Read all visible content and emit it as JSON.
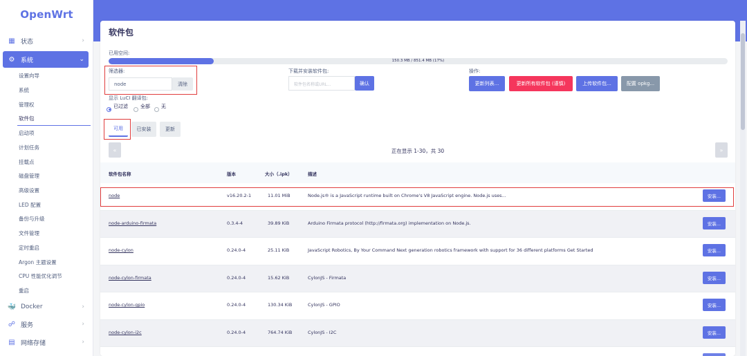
{
  "brand": "OpenWrt",
  "sidebar": {
    "top_items": [
      {
        "label": "状态"
      },
      {
        "label": "系统"
      },
      {
        "label": "Docker"
      },
      {
        "label": "服务"
      },
      {
        "label": "网络存储"
      }
    ],
    "sub_items": [
      {
        "label": "设置向导"
      },
      {
        "label": "系统"
      },
      {
        "label": "管理权"
      },
      {
        "label": "软件包"
      },
      {
        "label": "启动项"
      },
      {
        "label": "计划任务"
      },
      {
        "label": "挂载点"
      },
      {
        "label": "磁盘管理"
      },
      {
        "label": "高级设置"
      },
      {
        "label": "LED 配置"
      },
      {
        "label": "备份与升级"
      },
      {
        "label": "文件管理"
      },
      {
        "label": "定时重启"
      },
      {
        "label": "Argon 主题设置"
      },
      {
        "label": "CPU 性能优化调节"
      },
      {
        "label": "重启"
      }
    ]
  },
  "page": {
    "title": "软件包",
    "space_label": "已用空间:",
    "space_text": "150.3 MB / 851.4 MB (17%)",
    "space_fraction": 0.17
  },
  "filter": {
    "label": "筛选器:",
    "value": "node",
    "clear_label": "清除"
  },
  "download": {
    "label": "下载并安装软件包:",
    "placeholder": "软件包名称或URL...",
    "confirm_label": "确认"
  },
  "actions": {
    "label": "操作:",
    "update_lists": "更新列表...",
    "upgrade_all": "更新所有软件包 (谨慎)",
    "upload": "上传软件包...",
    "configure": "配置 opkg..."
  },
  "luci": {
    "label": "显示 LuCI 翻译包:",
    "options": [
      "已过滤",
      "全部",
      "无"
    ],
    "selected": "已过滤"
  },
  "tabs": [
    "可用",
    "已安装",
    "更新"
  ],
  "pagination": {
    "prev": "«",
    "next": "»",
    "text": "正在显示 1-30，共 30"
  },
  "table": {
    "headers": [
      "软件包名称",
      "版本",
      "大小（.ipk）",
      "描述"
    ],
    "install_label": "安装...",
    "rows": [
      {
        "name": "node",
        "version": "v16.20.2-1",
        "size": "11.01 MiB",
        "desc": "Node.js® is a JavaScript runtime built on Chrome's V8 JavaScript engine. Node.js uses..."
      },
      {
        "name": "node-arduino-firmata",
        "version": "0.3.4-4",
        "size": "39.89 KiB",
        "desc": "Arduino Firmata protocol (http://firmata.org) implementation on Node.js."
      },
      {
        "name": "node-cylon",
        "version": "0.24.0-4",
        "size": "25.11 KiB",
        "desc": "JavaScript Robotics, By Your Command Next generation robotics framework with support for 36 different platforms Get Started"
      },
      {
        "name": "node-cylon-firmata",
        "version": "0.24.0-4",
        "size": "15.62 KiB",
        "desc": "CylonJS - Firmata"
      },
      {
        "name": "node-cylon-gpio",
        "version": "0.24.0-4",
        "size": "130.34 KiB",
        "desc": "CylonJS - GPIO"
      },
      {
        "name": "node-cylon-i2c",
        "version": "0.24.0-4",
        "size": "764.74 KiB",
        "desc": "CylonJS - I2C"
      }
    ]
  }
}
